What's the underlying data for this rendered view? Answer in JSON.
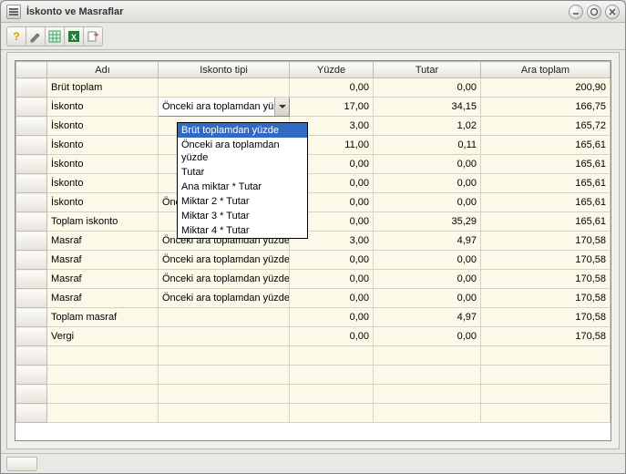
{
  "window": {
    "title": "İskonto ve Masraflar"
  },
  "toolbar": {
    "items": [
      {
        "name": "help-icon"
      },
      {
        "name": "edit-icon"
      },
      {
        "name": "grid-icon"
      },
      {
        "name": "excel-icon"
      },
      {
        "name": "export-icon"
      }
    ]
  },
  "columns": {
    "name": "Adı",
    "type": "Iskonto tipi",
    "percent": "Yüzde",
    "amount": "Tutar",
    "subtotal": "Ara toplam"
  },
  "rows": [
    {
      "name": "Brüt toplam",
      "type": "",
      "percent": "0,00",
      "amount": "0,00",
      "subtotal": "200,90"
    },
    {
      "name": "İskonto",
      "type": "Önceki ara toplamdan yüzde",
      "percent": "17,00",
      "amount": "34,15",
      "subtotal": "166,75",
      "dropdown": true
    },
    {
      "name": "İskonto",
      "type": "",
      "percent": "3,00",
      "amount": "1,02",
      "subtotal": "165,72"
    },
    {
      "name": "İskonto",
      "type": "",
      "percent": "11,00",
      "amount": "0,11",
      "subtotal": "165,61"
    },
    {
      "name": "İskonto",
      "type": "",
      "percent": "0,00",
      "amount": "0,00",
      "subtotal": "165,61"
    },
    {
      "name": "İskonto",
      "type": "",
      "percent": "0,00",
      "amount": "0,00",
      "subtotal": "165,61"
    },
    {
      "name": "İskonto",
      "type": "Önceki ara toplamdan yüzde",
      "percent": "0,00",
      "amount": "0,00",
      "subtotal": "165,61"
    },
    {
      "name": "Toplam iskonto",
      "type": "",
      "percent": "0,00",
      "amount": "35,29",
      "subtotal": "165,61"
    },
    {
      "name": "Masraf",
      "type": "Önceki ara toplamdan yüzde",
      "percent": "3,00",
      "amount": "4,97",
      "subtotal": "170,58"
    },
    {
      "name": "Masraf",
      "type": "Önceki ara toplamdan yüzde",
      "percent": "0,00",
      "amount": "0,00",
      "subtotal": "170,58"
    },
    {
      "name": "Masraf",
      "type": "Önceki ara toplamdan yüzde",
      "percent": "0,00",
      "amount": "0,00",
      "subtotal": "170,58"
    },
    {
      "name": "Masraf",
      "type": "Önceki ara toplamdan yüzde",
      "percent": "0,00",
      "amount": "0,00",
      "subtotal": "170,58"
    },
    {
      "name": "Toplam masraf",
      "type": "",
      "percent": "0,00",
      "amount": "4,97",
      "subtotal": "170,58"
    },
    {
      "name": "Vergi",
      "type": "",
      "percent": "0,00",
      "amount": "0,00",
      "subtotal": "170,58"
    }
  ],
  "blank_rows": 4,
  "dropdown_options": [
    "Brüt toplamdan yüzde",
    "Önceki ara toplamdan yüzde",
    "Tutar",
    "Ana miktar * Tutar",
    "Miktar 2 * Tutar",
    "Miktar 3 * Tutar",
    "Miktar 4 * Tutar"
  ],
  "dropdown_selected_index": 0
}
